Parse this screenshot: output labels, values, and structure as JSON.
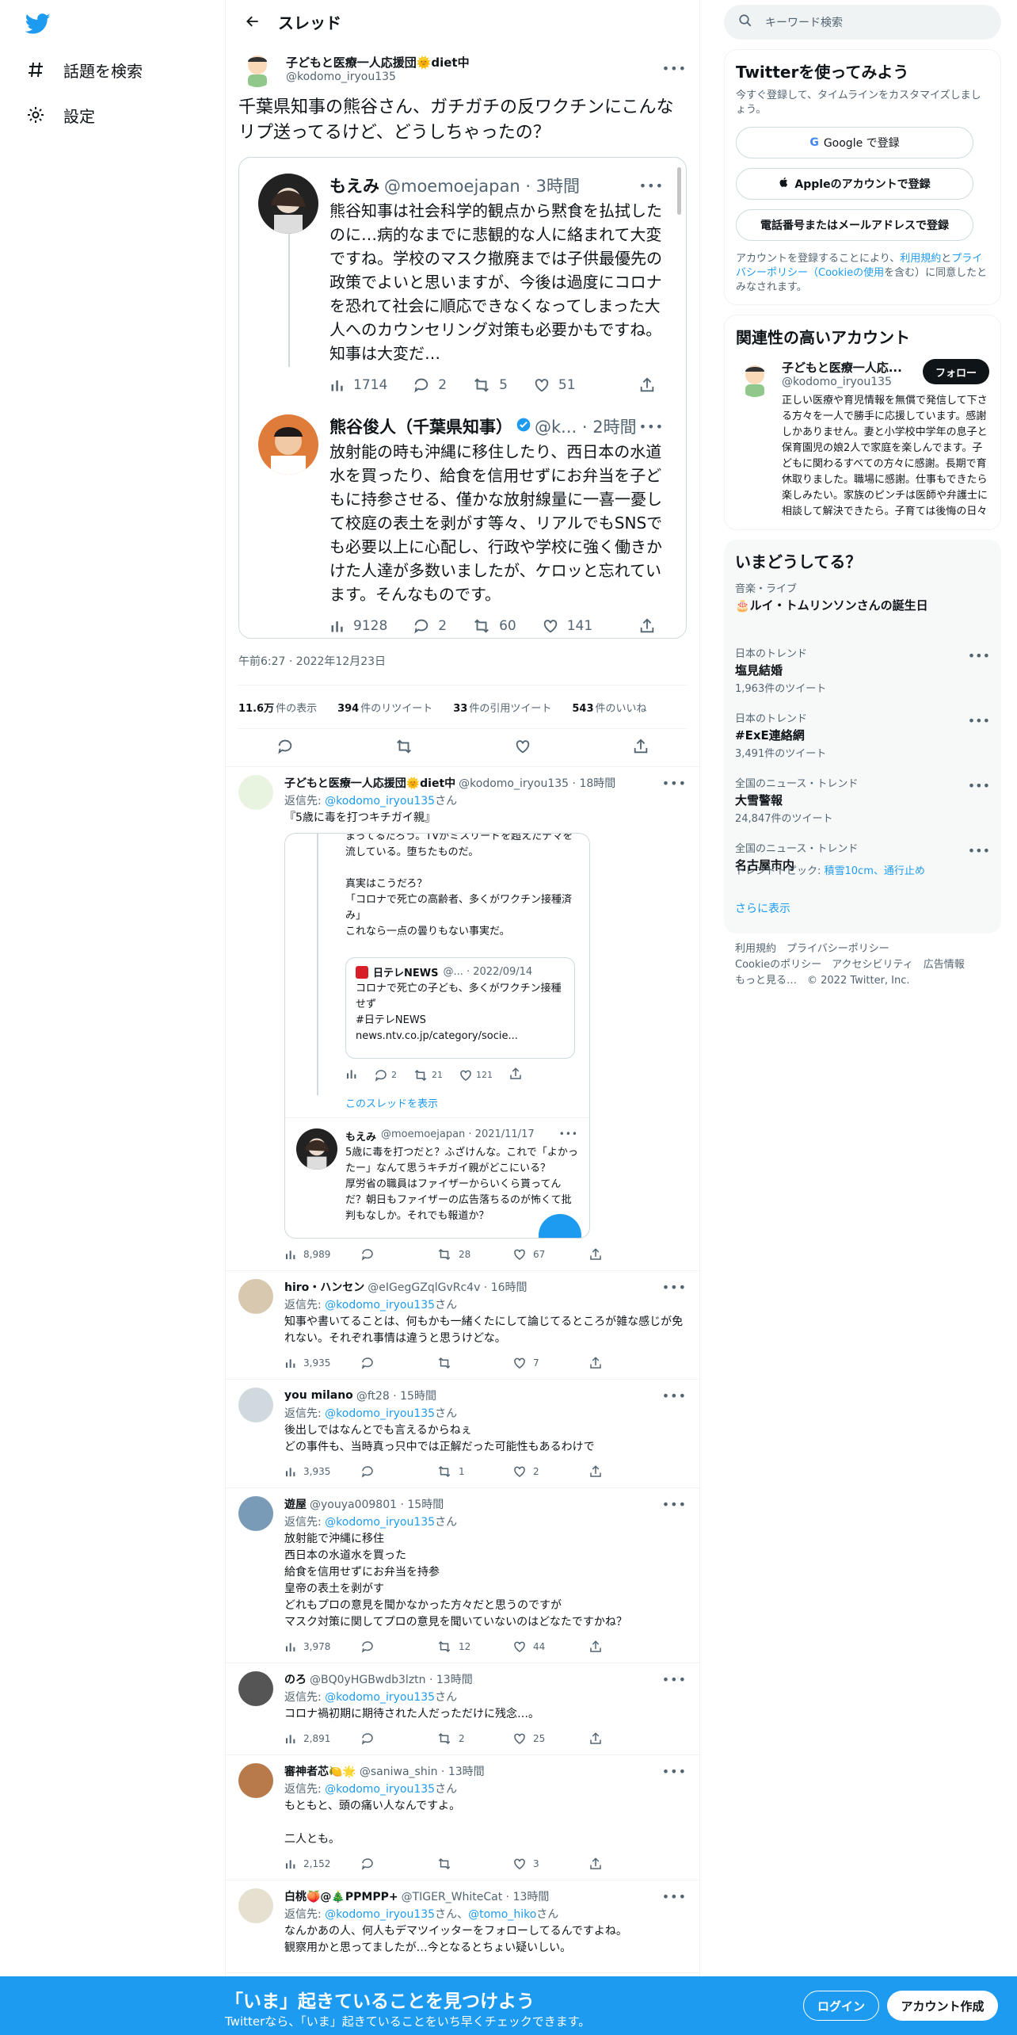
{
  "sidebar": {
    "items": [
      {
        "label": "話題を検索"
      },
      {
        "label": "設定"
      }
    ]
  },
  "header": {
    "title": "スレッド"
  },
  "focus": {
    "name": "子どもと医療一人応援団🌞diet中",
    "handle": "@kodomo_iryou135",
    "text": "千葉県知事の熊谷さん、ガチガチの反ワクチンにこんなリプ送ってるけど、どうしちゃったの？",
    "quote1": {
      "name": "もえみ",
      "handle": "@moemoejapan · 3時間",
      "text": "熊谷知事は社会科学的観点から黙食を払拭したのに…病的なまでに悲観的な人に絡まれて大変ですね。学校のマスク撤廃までは子供最優先の政策でよいと思いますが、今後は過度にコロナを恐れて社会に順応できなくなってしまった大人へのカウンセリング対策も必要かもですね。知事は大変だ…",
      "views": "1714",
      "replies": "2",
      "retweets": "5",
      "likes": "51"
    },
    "quote2": {
      "name": "熊谷俊人（千葉県知事）",
      "handle": "@k... · 2時間",
      "text": "放射能の時も沖縄に移住したり、西日本の水道水を買ったり、給食を信用せずにお弁当を子どもに持参させる、僅かな放射線量に一喜一憂して校庭の表土を剥がす等々、リアルでもSNSでも必要以上に心配し、行政や学校に強く働きかけた人達が多数いましたが、ケロッと忘れています。そんなものです。",
      "views": "9128",
      "replies": "2",
      "retweets": "60",
      "likes": "141"
    },
    "time": "午前6:27 · 2022年12月23日",
    "stats": [
      {
        "num": "11.6万",
        "label": "件の表示"
      },
      {
        "num": "394",
        "label": "件のリツイート"
      },
      {
        "num": "33",
        "label": "件の引用ツイート"
      },
      {
        "num": "543",
        "label": "件のいいね"
      }
    ]
  },
  "replies": [
    {
      "name": "子どもと医療一人応援団🌞diet中",
      "handle": "@kodomo_iryou135 · 18時間",
      "to_label": "返信先: ",
      "to": "@kodomo_iryou135",
      "to_suffix": "さん",
      "text": "『5歳に毒を打つキチガイ親』",
      "inner": {
        "text": "まってるだろう。TVがミスリードを超えたデマを流している。堕ちたものだ。\n\n真実はこうだろ？\n「コロナで死亡の高齢者、多くがワクチン接種済み」\nこれなら一点の曇りもない事実だ。",
        "news_name": "日テレNEWS",
        "news_meta": "@... · 2022/09/14",
        "news_text": "コロナで死亡の子ども、多くがワクチン接種せず\n#日テレNEWS\nnews.ntv.co.jp/category/socie...",
        "n_replies": "2",
        "n_rts": "21",
        "n_likes": "121",
        "show_thread": "このスレッドを表示",
        "m_name": "もえみ",
        "m_handle": "@moemoejapan · 2021/11/17",
        "m_text": "5歳に毒を打つだと？ふざけんな。これで「よかったー」なんて思うキチガイ親がどこにいる？\n厚労省の職員はファイザーからいくら貰ってんだ？朝日もファイザーの広告落ちるのが怖くて批判もなしか。それでも報道か？"
      },
      "views": "8,989",
      "rts": "28",
      "likes": "67"
    },
    {
      "name": "hiro・ハンセン",
      "handle": "@eIGegGZqlGvRc4v · 16時間",
      "to_label": "返信先: ",
      "to": "@kodomo_iryou135",
      "to_suffix": "さん",
      "text": "知事や書いてることは、何もかも一緒くたにして論じてるところが雑な感じが免れない。それぞれ事情は違うと思うけどな。",
      "views": "3,935",
      "rts": "",
      "likes": "7"
    },
    {
      "name": "you milano",
      "handle": "@ft28 · 15時間",
      "to_label": "返信先: ",
      "to": "@kodomo_iryou135",
      "to_suffix": "さん",
      "text": "後出しではなんとでも言えるからねぇ\nどの事件も、当時真っ只中では正解だった可能性もあるわけで",
      "views": "3,935",
      "rts": "1",
      "likes": "2"
    },
    {
      "name": "遊屋",
      "handle": "@youya009801 · 15時間",
      "to_label": "返信先: ",
      "to": "@kodomo_iryou135",
      "to_suffix": "さん",
      "text": "放射能で沖縄に移住\n西日本の水道水を買った\n給食を信用せずにお弁当を持参\n皇帝の表土を剥がす\nどれもプロの意見を聞かなかった方々だと思うのですが\nマスク対策に関してプロの意見を聞いていないのはどなたですかね？",
      "views": "3,978",
      "rts": "12",
      "likes": "44"
    },
    {
      "name": "のろ",
      "handle": "@BQ0yHGBwdb3lztn · 13時間",
      "to_label": "返信先: ",
      "to": "@kodomo_iryou135",
      "to_suffix": "さん",
      "text": "コロナ禍初期に期待された人だっただけに残念…。",
      "views": "2,891",
      "rts": "2",
      "likes": "25"
    },
    {
      "name": "審神者芯🍋🌟",
      "handle": "@saniwa_shin · 13時間",
      "to_label": "返信先: ",
      "to": "@kodomo_iryou135",
      "to_suffix": "さん",
      "text": "もともと、頭の痛い人なんですよ。\n\n二人とも。",
      "views": "2,152",
      "rts": "",
      "likes": "3"
    },
    {
      "name": "白桃🍑@🎄PPMPP+",
      "handle": "@TIGER_WhiteCat · 13時間",
      "to_label": "返信先: ",
      "to": "@kodomo_iryou135",
      "to_suffix": "さん、",
      "to2": "@tomo_hiko",
      "to2_suffix": "さん",
      "text": "なんかあの人、何人もデマツイッターをフォローしてるんですよね。\n観察用かと思ってましたが…今となるとちょい疑いしい。",
      "views": "",
      "rts": "",
      "likes": ""
    }
  ],
  "right": {
    "search_placeholder": "キーワード検索",
    "signup": {
      "title": "Twitterを使ってみよう",
      "sub": "今すぐ登録して、タイムラインをカスタマイズしましょう。",
      "google": "Google で登録",
      "apple": "Appleのアカウントで登録",
      "phone": "電話番号またはメールアドレスで登録",
      "legal1": "アカウントを登録することにより、",
      "legal_link1": "利用規約",
      "legal2": "と",
      "legal_link2": "プライバシーポリシー（Cookieの使用",
      "legal3": "を含む）に同意したとみなされます。"
    },
    "related": {
      "title": "関連性の高いアカウント",
      "name": "子どもと医療一人応...",
      "handle": "@kodomo_iryou135",
      "follow": "フォロー",
      "bio": "正しい医療や育児情報を無償で発信して下さる方々を一人で勝手に応援しています。感謝しかありません。妻と小学校中学年の息子と保育園児の娘2人で家庭を楽しんでます。子どもに関わるすべての方々に感謝。長期で育休取りました。職場に感謝。仕事もできたら楽しみたい。家族のピンチは医師や弁護士に相談して解決できたら。子育ては後悔の日々"
    },
    "trends": {
      "title": "いまどうしてる？",
      "items": [
        {
          "cat": "音楽・ライブ",
          "name": "🎂ルイ・トムリンソンさんの誕生日",
          "count": ""
        },
        {
          "cat": "日本のトレンド",
          "name": "塩見結婚",
          "count": "1,963件のツイート"
        },
        {
          "cat": "日本のトレンド",
          "name": "#ExE連絡網",
          "count": "3,491件のツイート"
        },
        {
          "cat": "全国のニュース・トレンド",
          "name": "大雪警報",
          "count": "24,847件のツイート"
        },
        {
          "cat": "全国のニュース・トレンド",
          "name": "名古屋市内",
          "count": "",
          "topic_label": "トレンドトピック: ",
          "topic": "積雪10cm、通行止め"
        }
      ],
      "more": "さらに表示"
    },
    "footer": {
      "line1": "利用規約　プライバシーポリシー",
      "line2": "Cookieのポリシー　アクセシビリティ　広告情報",
      "line3": "もっと見る…　© 2022 Twitter, Inc."
    }
  },
  "bottom": {
    "title": "「いま」起きていることを見つけよう",
    "sub": "Twitterなら、「いま」起きていることをいち早くチェックできます。",
    "login": "ログイン",
    "signup": "アカウント作成"
  },
  "colors": {
    "accent": "#1d9bf0",
    "text": "#0f1419",
    "muted": "#536471",
    "border": "#eff3f4"
  },
  "icons": {
    "logo": "twitter-bird-icon",
    "explore": "hashtag-icon",
    "settings": "gear-icon"
  }
}
